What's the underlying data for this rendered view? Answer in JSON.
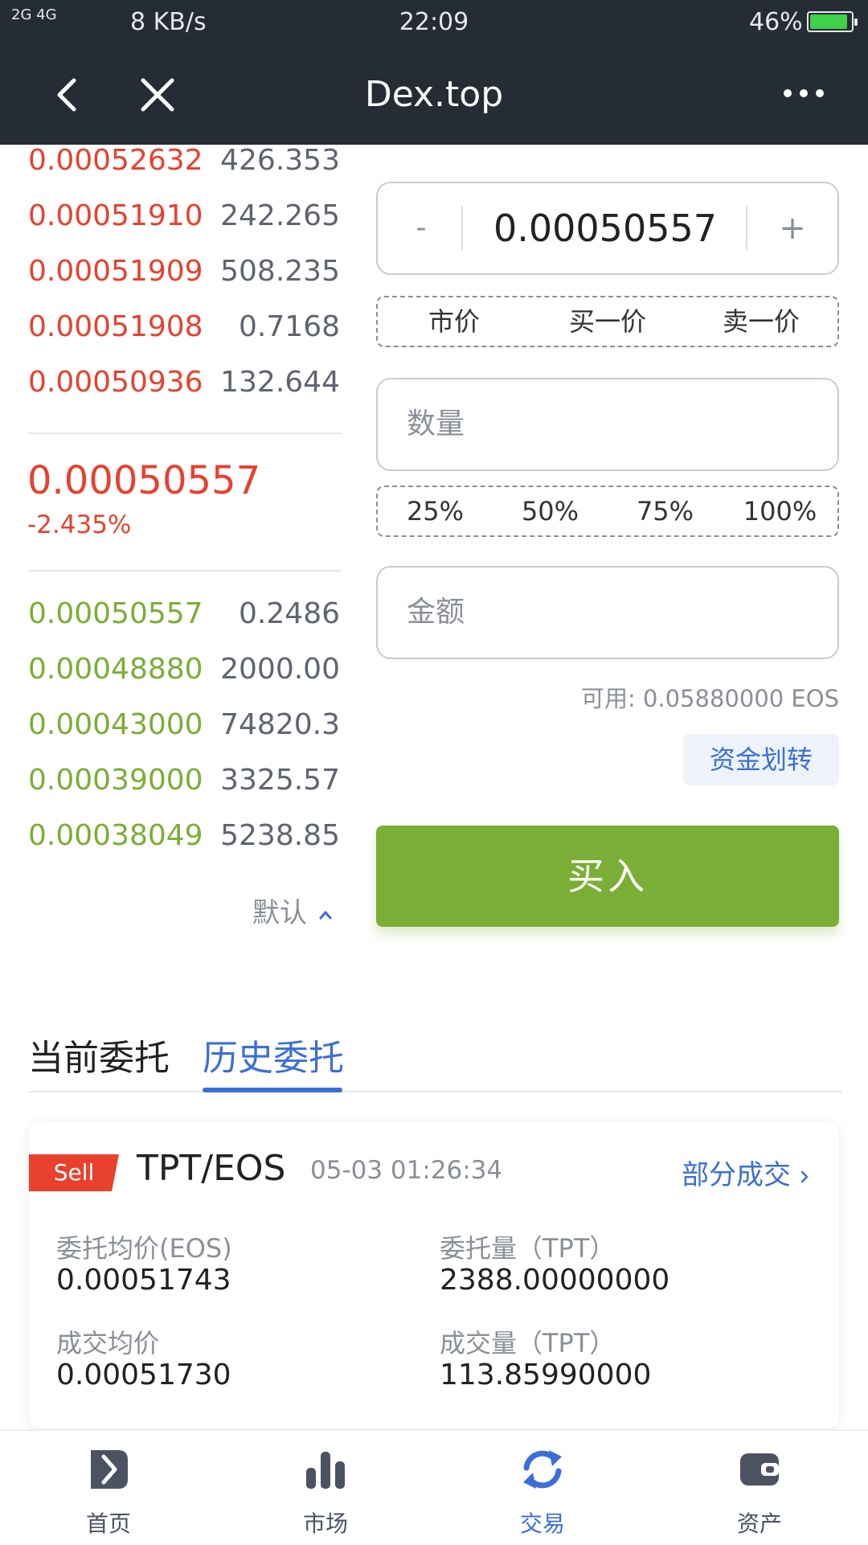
{
  "status_bar": {
    "network": "2G 4G",
    "speed": "8 KB/s",
    "time": "22:09",
    "battery": "46%"
  },
  "header": {
    "title": "Dex.top"
  },
  "order_book": {
    "asks": [
      {
        "price": "0.00052632",
        "qty": "426.353"
      },
      {
        "price": "0.00051910",
        "qty": "242.265"
      },
      {
        "price": "0.00051909",
        "qty": "508.235"
      },
      {
        "price": "0.00051908",
        "qty": "0.7168"
      },
      {
        "price": "0.00050936",
        "qty": "132.644"
      }
    ],
    "last_price": "0.00050557",
    "change": "-2.435%",
    "bids": [
      {
        "price": "0.00050557",
        "qty": "0.2486"
      },
      {
        "price": "0.00048880",
        "qty": "2000.00"
      },
      {
        "price": "0.00043000",
        "qty": "74820.3"
      },
      {
        "price": "0.00039000",
        "qty": "3325.57"
      },
      {
        "price": "0.00038049",
        "qty": "5238.85"
      }
    ],
    "sort_label": "默认"
  },
  "trade_form": {
    "minus": "-",
    "plus": "+",
    "price_value": "0.00050557",
    "quick_price": [
      "市价",
      "买一价",
      "卖一价"
    ],
    "quantity_placeholder": "数量",
    "percentages": [
      "25%",
      "50%",
      "75%",
      "100%"
    ],
    "amount_placeholder": "金额",
    "available": "可用: 0.05880000 EOS",
    "transfer_label": "资金划转",
    "buy_label": "买入"
  },
  "tabs": {
    "current": "当前委托",
    "history": "历史委托"
  },
  "order_card": {
    "side": "Sell",
    "pair": "TPT/EOS",
    "time": "05-03 01:26:34",
    "status": "部分成交",
    "fields": {
      "avg_order_price_label": "委托均价(EOS)",
      "avg_order_price": "0.00051743",
      "order_qty_label": "委托量（TPT）",
      "order_qty": "2388.00000000",
      "avg_fill_price_label": "成交均价",
      "avg_fill_price": "0.00051730",
      "fill_qty_label": "成交量（TPT）",
      "fill_qty": "113.85990000"
    }
  },
  "bottom_nav": [
    {
      "label": "首页",
      "icon": "home-logo-icon"
    },
    {
      "label": "市场",
      "icon": "bar-chart-icon"
    },
    {
      "label": "交易",
      "icon": "exchange-arrows-icon"
    },
    {
      "label": "资产",
      "icon": "wallet-icon"
    }
  ],
  "colors": {
    "header_bg": "#262c35",
    "ask_red": "#e8412e",
    "bid_green": "#7bae36",
    "accent_blue": "#3c6fd6",
    "buy_green": "#7bae36"
  }
}
